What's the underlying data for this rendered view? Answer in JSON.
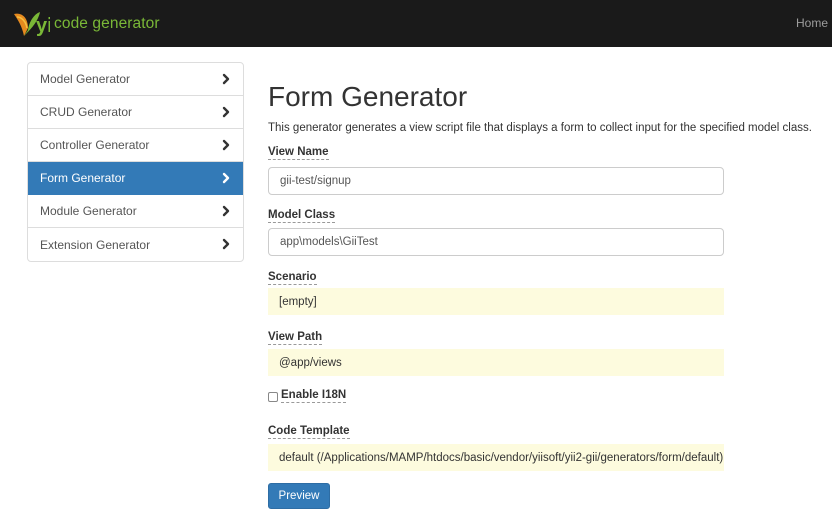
{
  "navbar": {
    "brand_logo_text": "yii",
    "brand_text": "code generator",
    "home_link": "Home"
  },
  "sidebar": {
    "items": [
      {
        "label": "Model Generator",
        "active": false
      },
      {
        "label": "CRUD Generator",
        "active": false
      },
      {
        "label": "Controller Generator",
        "active": false
      },
      {
        "label": "Form Generator",
        "active": true
      },
      {
        "label": "Module Generator",
        "active": false
      },
      {
        "label": "Extension Generator",
        "active": false
      }
    ]
  },
  "main": {
    "title": "Form Generator",
    "description": "This generator generates a view script file that displays a form to collect input for the specified model class.",
    "fields": {
      "view_name": {
        "label": "View Name",
        "value": "gii-test/signup"
      },
      "model_class": {
        "label": "Model Class",
        "value": "app\\models\\GiiTest"
      },
      "scenario": {
        "label": "Scenario",
        "value": "[empty]"
      },
      "view_path": {
        "label": "View Path",
        "value": "@app/views"
      },
      "enable_i18n": {
        "label": "Enable I18N",
        "checked": false
      },
      "code_template": {
        "label": "Code Template",
        "value": "default (/Applications/MAMP/htdocs/basic/vendor/yiisoft/yii2-gii/generators/form/default)"
      }
    },
    "preview_button": "Preview"
  },
  "colors": {
    "navbar_bg": "#1a1a1a",
    "brand_green": "#7ab837",
    "active_blue": "#337ab7",
    "sticky_bg": "#fdfbde"
  }
}
